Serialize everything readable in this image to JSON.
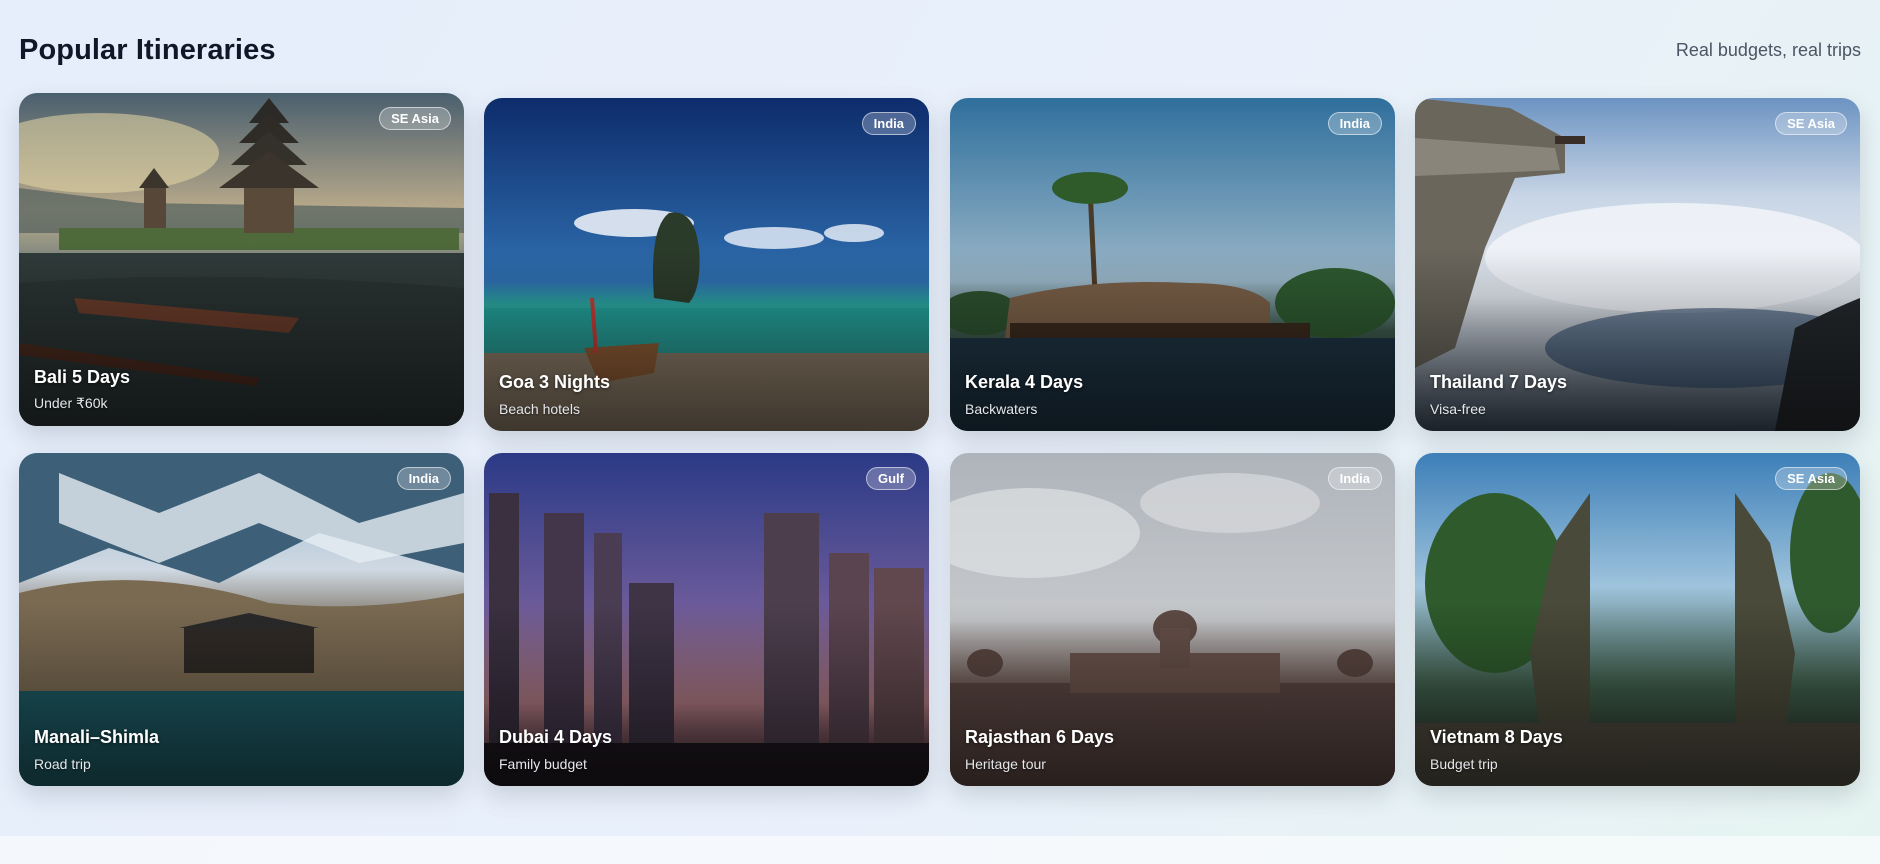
{
  "section": {
    "title": "Popular Itineraries",
    "subtitle": "Real budgets, real trips"
  },
  "cards": [
    {
      "title": "Bali 5 Days",
      "subtitle": "Under ₹60k",
      "badge": "SE Asia",
      "scene": "temple-lake"
    },
    {
      "title": "Goa 3 Nights",
      "subtitle": "Beach hotels",
      "badge": "India",
      "scene": "beach-boat"
    },
    {
      "title": "Kerala 4 Days",
      "subtitle": "Backwaters",
      "badge": "India",
      "scene": "houseboat"
    },
    {
      "title": "Thailand 7 Days",
      "subtitle": "Visa-free",
      "badge": "SE Asia",
      "scene": "cliff-clouds"
    },
    {
      "title": "Manali–Shimla",
      "subtitle": "Road trip",
      "badge": "India",
      "scene": "mountain-lake"
    },
    {
      "title": "Dubai 4 Days",
      "subtitle": "Family budget",
      "badge": "Gulf",
      "scene": "city-dusk"
    },
    {
      "title": "Rajasthan 6 Days",
      "subtitle": "Heritage tour",
      "badge": "India",
      "scene": "palace"
    },
    {
      "title": "Vietnam 8 Days",
      "subtitle": "Budget trip",
      "badge": "SE Asia",
      "scene": "temple-gate"
    }
  ]
}
